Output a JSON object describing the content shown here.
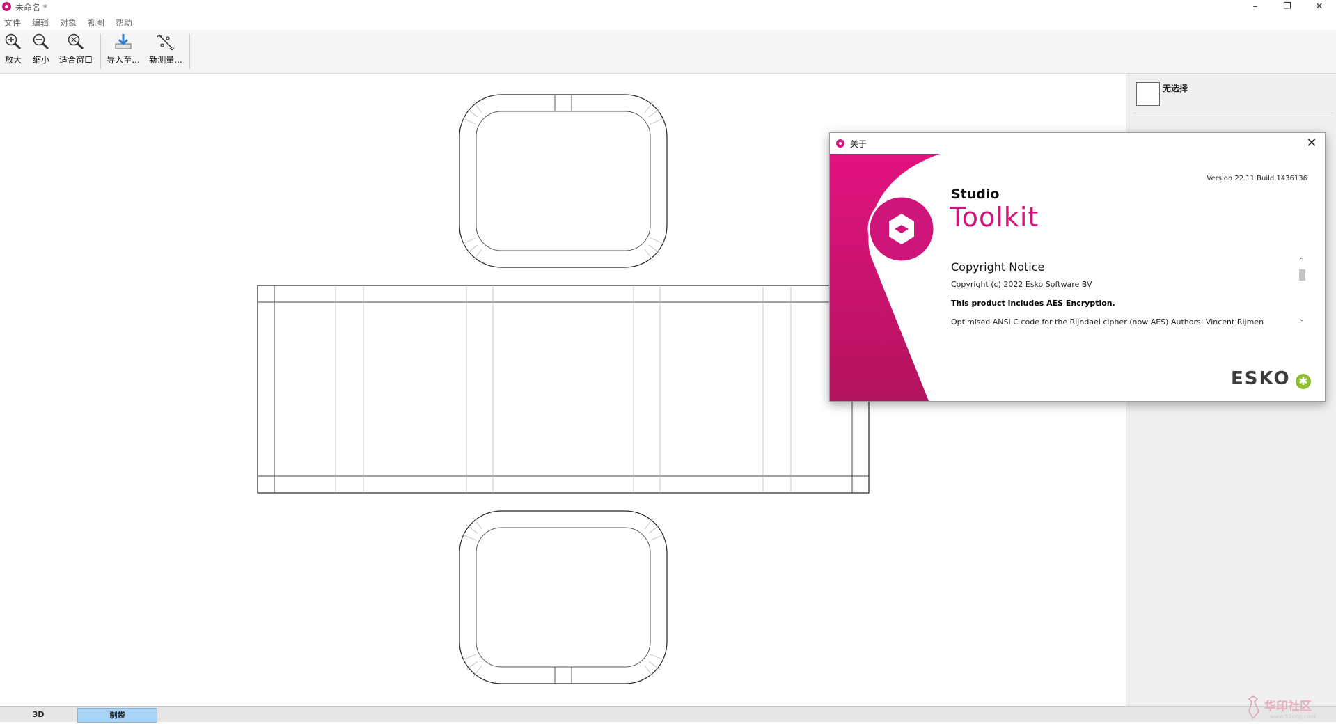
{
  "window": {
    "title": "未命名 *",
    "minimize_icon": "minimize-icon",
    "restore_icon": "restore-icon",
    "close_icon": "close-icon"
  },
  "menu": [
    "文件",
    "编辑",
    "对象",
    "视图",
    "帮助"
  ],
  "toolbar": {
    "zoom_in": "放大",
    "zoom_out": "缩小",
    "fit_window": "适合窗口",
    "import_to": "导入至...",
    "new_measure": "新测量..."
  },
  "right_panel": {
    "selection_label": "无选择"
  },
  "status_tabs": [
    "3D",
    "制袋"
  ],
  "about_dialog": {
    "title": "关于",
    "version": "Version 22.11 Build 1436136",
    "product_line": "Studio",
    "product_name": "Toolkit",
    "copyright_heading": "Copyright Notice",
    "copyright_line": "Copyright (c) 2022 Esko Software BV",
    "aes_line": "This product includes AES Encryption.",
    "aes_detail": "Optimised ANSI C code for the Rijndael cipher (now AES) Authors: Vincent Rijmen Antoon Bosselaers Paulo Barreto. All rights reserved in this distribution including the copyright notice.",
    "brand": "ESKO",
    "colors": {
      "accent": "#d0157a",
      "brand_green": "#8fbf2e"
    }
  },
  "watermark": "www.52cnp.com"
}
